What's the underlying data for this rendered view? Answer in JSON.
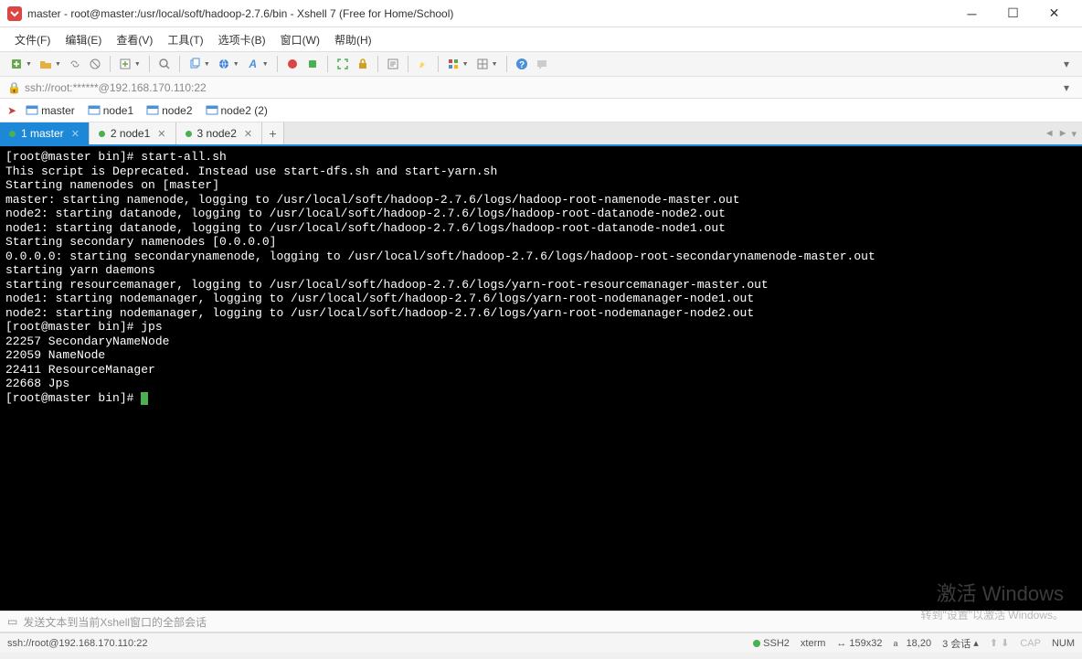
{
  "title": "master - root@master:/usr/local/soft/hadoop-2.7.6/bin - Xshell 7 (Free for Home/School)",
  "menu": {
    "file": "文件(F)",
    "edit": "编辑(E)",
    "view": "查看(V)",
    "tools": "工具(T)",
    "tabs": "选项卡(B)",
    "window": "窗口(W)",
    "help": "帮助(H)"
  },
  "address": "ssh://root:******@192.168.170.110:22",
  "sessions": [
    "master",
    "node1",
    "node2",
    "node2 (2)"
  ],
  "tabs": [
    {
      "label": "1 master",
      "active": true
    },
    {
      "label": "2 node1",
      "active": false
    },
    {
      "label": "3 node2",
      "active": false
    }
  ],
  "terminal_lines": [
    "[root@master bin]# start-all.sh",
    "This script is Deprecated. Instead use start-dfs.sh and start-yarn.sh",
    "Starting namenodes on [master]",
    "master: starting namenode, logging to /usr/local/soft/hadoop-2.7.6/logs/hadoop-root-namenode-master.out",
    "node2: starting datanode, logging to /usr/local/soft/hadoop-2.7.6/logs/hadoop-root-datanode-node2.out",
    "node1: starting datanode, logging to /usr/local/soft/hadoop-2.7.6/logs/hadoop-root-datanode-node1.out",
    "Starting secondary namenodes [0.0.0.0]",
    "0.0.0.0: starting secondarynamenode, logging to /usr/local/soft/hadoop-2.7.6/logs/hadoop-root-secondarynamenode-master.out",
    "starting yarn daemons",
    "starting resourcemanager, logging to /usr/local/soft/hadoop-2.7.6/logs/yarn-root-resourcemanager-master.out",
    "node1: starting nodemanager, logging to /usr/local/soft/hadoop-2.7.6/logs/yarn-root-nodemanager-node1.out",
    "node2: starting nodemanager, logging to /usr/local/soft/hadoop-2.7.6/logs/yarn-root-nodemanager-node2.out",
    "[root@master bin]# jps",
    "22257 SecondaryNameNode",
    "22059 NameNode",
    "22411 ResourceManager",
    "22668 Jps",
    "[root@master bin]# "
  ],
  "input_hint": "发送文本到当前Xshell窗口的全部会话",
  "watermark": {
    "title": "激活 Windows",
    "sub": "转到\"设置\"以激活 Windows。"
  },
  "status": {
    "left": "ssh://root@192.168.170.110:22",
    "ssh": "SSH2",
    "term": "xterm",
    "size": "159x32",
    "pos": "18,20",
    "sessions": "3 会话",
    "caps": "CAP",
    "num": "NUM"
  }
}
